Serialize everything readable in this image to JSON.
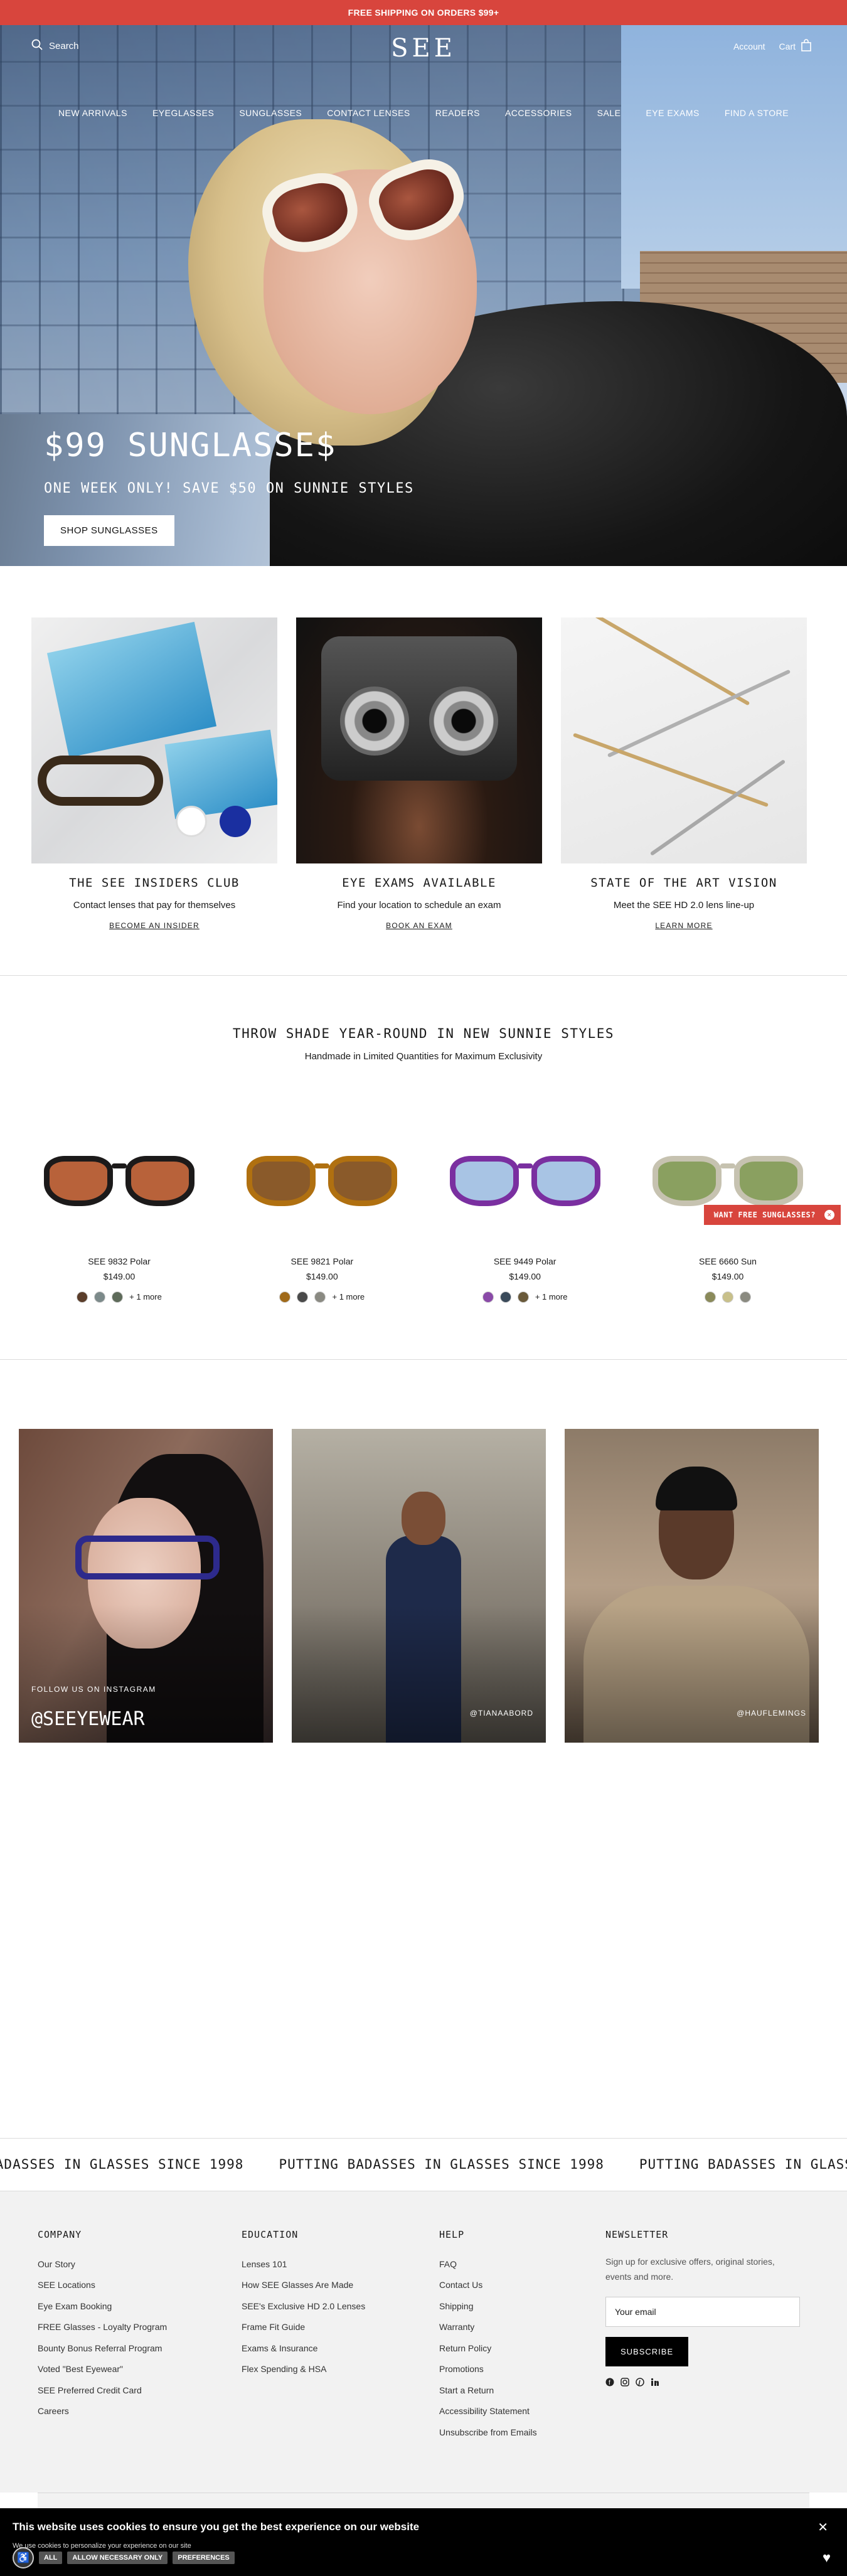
{
  "promo": {
    "text": "FREE SHIPPING ON ORDERS $99+"
  },
  "header": {
    "search_label": "Search",
    "logo": "SEE",
    "account_label": "Account",
    "cart_label": "Cart"
  },
  "nav": [
    "NEW ARRIVALS",
    "EYEGLASSES",
    "SUNGLASSES",
    "CONTACT LENSES",
    "READERS",
    "ACCESSORIES",
    "SALE",
    "EYE EXAMS",
    "FIND A STORE"
  ],
  "hero": {
    "title": "$99 SUNGLASSE$",
    "subtitle": "ONE WEEK ONLY! SAVE $50 ON SUNNIE STYLES",
    "cta": "SHOP SUNGLASSES"
  },
  "features": [
    {
      "title": "THE SEE INSIDERS CLUB",
      "text": "Contact lenses that pay for themselves",
      "link": "BECOME AN INSIDER"
    },
    {
      "title": "EYE EXAMS AVAILABLE",
      "text": "Find your location to schedule an exam",
      "link": "BOOK AN EXAM"
    },
    {
      "title": "STATE OF THE ART VISION",
      "text": "Meet the SEE HD 2.0 lens line-up",
      "link": "LEARN MORE"
    }
  ],
  "products_section": {
    "title": "THROW SHADE YEAR-ROUND IN NEW SUNNIE STYLES",
    "subtitle": "Handmade in Limited Quantities for Maximum Exclusivity",
    "popup": "WANT FREE SUNGLASSES?",
    "items": [
      {
        "name": "SEE 9832 Polar",
        "price": "$149.00",
        "more": "+ 1 more",
        "frame_color": "#1c1a1a",
        "lens_color": "#b8623a",
        "swatches": [
          "#5a3d2a",
          "#7c8a8a",
          "#5e6b5a"
        ]
      },
      {
        "name": "SEE 9821 Polar",
        "price": "$149.00",
        "more": "+ 1 more",
        "frame_color": "#b07010",
        "lens_color": "#8a5a2a",
        "swatches": [
          "#a06a1a",
          "#4a4a4a",
          "#8a8a82"
        ]
      },
      {
        "name": "SEE 9449 Polar",
        "price": "$149.00",
        "more": "+ 1 more",
        "frame_color": "#7a2fa0",
        "lens_color": "#a8c4e4",
        "swatches": [
          "#8a4aa8",
          "#3a4a5a",
          "#6a5a3a"
        ]
      },
      {
        "name": "SEE 6660 Sun",
        "price": "$149.00",
        "more": "",
        "frame_color": "#c6c2b0",
        "lens_color": "#8aa060",
        "swatches": [
          "#8a8a5a",
          "#c8c08a",
          "#8a8a80"
        ]
      }
    ]
  },
  "instagram": {
    "follow_label": "FOLLOW US ON INSTAGRAM",
    "main_handle": "@SEEYEWEAR",
    "posts": [
      "@TIANAABORD",
      "@HAUFLEMINGS"
    ]
  },
  "marquee": {
    "text": "PUTTING BADASSES IN GLASSES SINCE 1998"
  },
  "footer": {
    "company": {
      "title": "COMPANY",
      "links": [
        "Our Story",
        "SEE Locations",
        "Eye Exam Booking",
        "FREE Glasses - Loyalty Program",
        "Bounty Bonus Referral Program",
        "Voted \"Best Eyewear\"",
        "SEE Preferred Credit Card",
        "Careers"
      ]
    },
    "education": {
      "title": "EDUCATION",
      "links": [
        "Lenses 101",
        "How SEE Glasses Are Made",
        "SEE's Exclusive HD 2.0 Lenses",
        "Frame Fit Guide",
        "Exams & Insurance",
        "Flex Spending & HSA"
      ]
    },
    "help": {
      "title": "HELP",
      "links": [
        "FAQ",
        "Contact Us",
        "Shipping",
        "Warranty",
        "Return Policy",
        "Promotions",
        "Start a Return",
        "Accessibility Statement",
        "Unsubscribe from Emails"
      ]
    },
    "newsletter": {
      "title": "NEWSLETTER",
      "text": "Sign up for exclusive offers, original stories, events and more.",
      "placeholder": "Your email",
      "button": "SUBSCRIBE"
    }
  },
  "cookie": {
    "title": "This website uses cookies to ensure you get the best experience on our website",
    "text": "We use cookies to personalize your experience on our site",
    "buttons": [
      "ALL",
      "ALLOW NECESSARY ONLY",
      "PREFERENCES"
    ]
  },
  "icons": {
    "search": "search-icon",
    "cart": "cart-icon",
    "close": "close-icon",
    "heart": "heart-icon",
    "accessibility": "accessibility-icon"
  }
}
